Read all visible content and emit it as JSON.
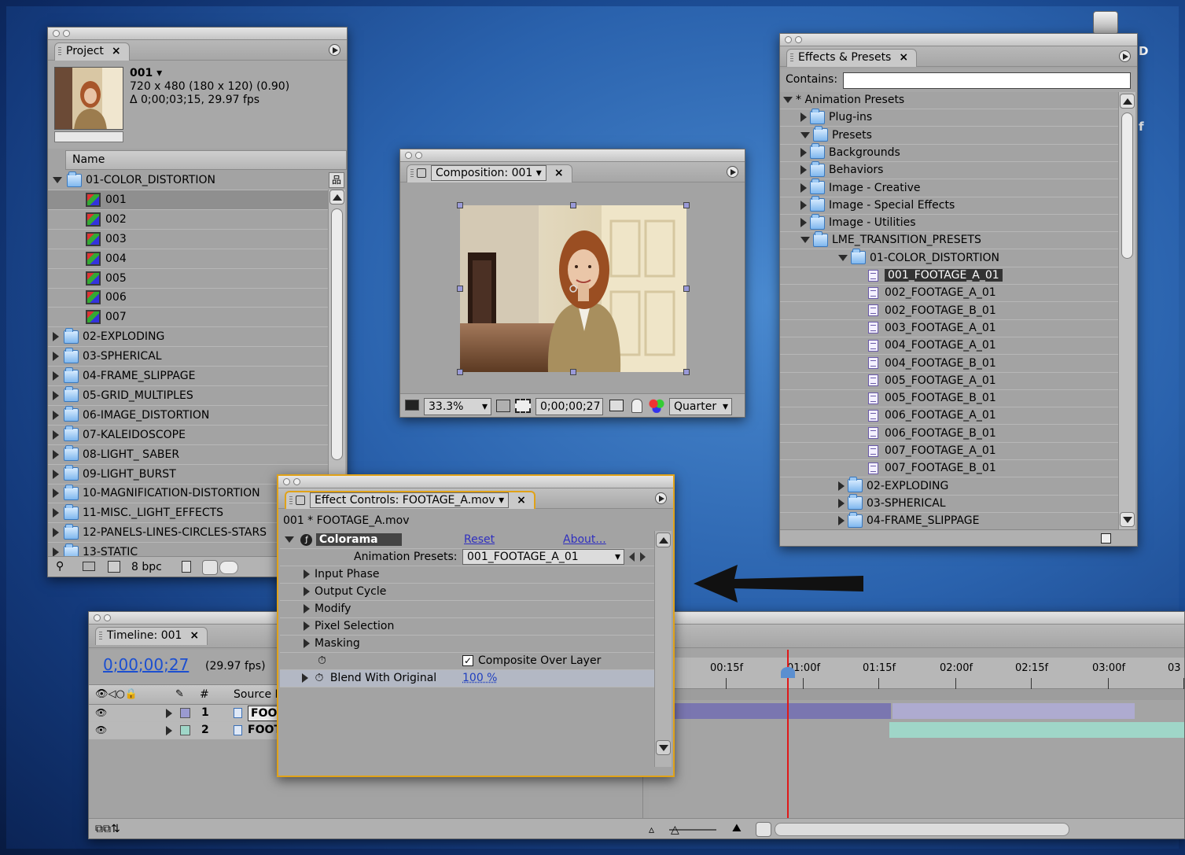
{
  "desktop": {
    "accent_color": "#2a62ad",
    "edge_text_1": "D",
    "edge_text_2": "f"
  },
  "project_panel": {
    "tab_label": "Project",
    "comp_name": "001 ▾",
    "comp_dims": "720 x 480  (180 x 120) (0.90)",
    "comp_duration": "Δ 0;00;03;15, 29.97 fps",
    "column_name": "Name",
    "rows": [
      {
        "label": "01-COLOR_DISTORTION",
        "kind": "folder",
        "expanded": true
      },
      {
        "label": "001",
        "kind": "comp",
        "selected": true
      },
      {
        "label": "002",
        "kind": "comp"
      },
      {
        "label": "003",
        "kind": "comp"
      },
      {
        "label": "004",
        "kind": "comp"
      },
      {
        "label": "005",
        "kind": "comp"
      },
      {
        "label": "006",
        "kind": "comp"
      },
      {
        "label": "007",
        "kind": "comp"
      },
      {
        "label": "02-EXPLODING",
        "kind": "folder"
      },
      {
        "label": "03-SPHERICAL",
        "kind": "folder"
      },
      {
        "label": "04-FRAME_SLIPPAGE",
        "kind": "folder"
      },
      {
        "label": "05-GRID_MULTIPLES",
        "kind": "folder"
      },
      {
        "label": "06-IMAGE_DISTORTION",
        "kind": "folder"
      },
      {
        "label": "07-KALEIDOSCOPE",
        "kind": "folder"
      },
      {
        "label": "08-LIGHT_ SABER",
        "kind": "folder"
      },
      {
        "label": "09-LIGHT_BURST",
        "kind": "folder"
      },
      {
        "label": "10-MAGNIFICATION-DISTORTION",
        "kind": "folder"
      },
      {
        "label": "11-MISC._LIGHT_EFFECTS",
        "kind": "folder"
      },
      {
        "label": "12-PANELS-LINES-CIRCLES-STARS",
        "kind": "folder"
      },
      {
        "label": "13-STATIC",
        "kind": "folder"
      }
    ],
    "footer_bpc": "8 bpc"
  },
  "composition_panel": {
    "tab_label": "Composition: 001",
    "zoom": "33.3%",
    "timecode": "0;00;00;27",
    "resolution": "Quarter"
  },
  "effects_panel": {
    "tab_label": "Effects & Presets",
    "contains_label": "Contains:",
    "contains_value": "",
    "rows": [
      {
        "label": "* Animation Presets",
        "indent": 0,
        "kind": "root",
        "expanded": true
      },
      {
        "label": "Plug-ins",
        "indent": 1,
        "kind": "folder"
      },
      {
        "label": "Presets",
        "indent": 1,
        "kind": "folder",
        "expanded": true
      },
      {
        "label": "Backgrounds",
        "indent": 2,
        "kind": "folder"
      },
      {
        "label": "Behaviors",
        "indent": 2,
        "kind": "folder"
      },
      {
        "label": "Image - Creative",
        "indent": 2,
        "kind": "folder"
      },
      {
        "label": "Image - Special Effects",
        "indent": 2,
        "kind": "folder"
      },
      {
        "label": "Image - Utilities",
        "indent": 2,
        "kind": "folder"
      },
      {
        "label": "LME_TRANSITION_PRESETS",
        "indent": 2,
        "kind": "folder",
        "expanded": true
      },
      {
        "label": "01-COLOR_DISTORTION",
        "indent": 3,
        "kind": "folder",
        "expanded": true
      },
      {
        "label": "001_FOOTAGE_A_01",
        "indent": 4,
        "kind": "preset",
        "selected": true
      },
      {
        "label": "002_FOOTAGE_A_01",
        "indent": 4,
        "kind": "preset"
      },
      {
        "label": "002_FOOTAGE_B_01",
        "indent": 4,
        "kind": "preset"
      },
      {
        "label": "003_FOOTAGE_A_01",
        "indent": 4,
        "kind": "preset"
      },
      {
        "label": "004_FOOTAGE_A_01",
        "indent": 4,
        "kind": "preset"
      },
      {
        "label": "004_FOOTAGE_B_01",
        "indent": 4,
        "kind": "preset"
      },
      {
        "label": "005_FOOTAGE_A_01",
        "indent": 4,
        "kind": "preset"
      },
      {
        "label": "005_FOOTAGE_B_01",
        "indent": 4,
        "kind": "preset"
      },
      {
        "label": "006_FOOTAGE_A_01",
        "indent": 4,
        "kind": "preset"
      },
      {
        "label": "006_FOOTAGE_B_01",
        "indent": 4,
        "kind": "preset"
      },
      {
        "label": "007_FOOTAGE_A_01",
        "indent": 4,
        "kind": "preset"
      },
      {
        "label": "007_FOOTAGE_B_01",
        "indent": 4,
        "kind": "preset"
      },
      {
        "label": "02-EXPLODING",
        "indent": 3,
        "kind": "folder"
      },
      {
        "label": "03-SPHERICAL",
        "indent": 3,
        "kind": "folder"
      },
      {
        "label": "04-FRAME_SLIPPAGE",
        "indent": 3,
        "kind": "folder"
      }
    ]
  },
  "effect_controls": {
    "tab_label": "Effect Controls: FOOTAGE_A.mov",
    "layer_path": "001 * FOOTAGE_A.mov",
    "effect_name": "Colorama",
    "reset_label": "Reset",
    "about_label": "About...",
    "presets_label": "Animation Presets:",
    "presets_value": "001_FOOTAGE_A_01",
    "properties": [
      "Input Phase",
      "Output Cycle",
      "Modify",
      "Pixel Selection",
      "Masking"
    ],
    "composite_label": "Composite Over Layer",
    "blend_label": "Blend With Original",
    "blend_value": "100 %",
    "highlight_color": "#f0b020"
  },
  "timeline_panel": {
    "tab_label": "Timeline: 001",
    "timecode": "0;00;00;27",
    "fps": "(29.97 fps)",
    "column_num": "#",
    "column_source": "Source N",
    "layers": [
      {
        "num": "1",
        "name": "FOOT",
        "color": "#9a9ad0"
      },
      {
        "num": "2",
        "name": "FOOT",
        "color": "#9fd6c8"
      }
    ],
    "ruler_labels": [
      "00:15f",
      "01:00f",
      "01:15f",
      "02:00f",
      "02:15f",
      "03:00f",
      "03"
    ]
  }
}
